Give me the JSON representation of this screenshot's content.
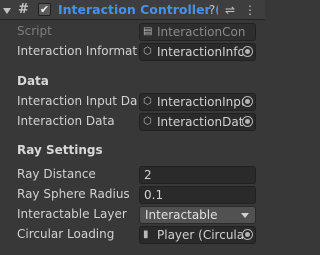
{
  "header": {
    "title": "Interaction Controller (S",
    "enabled_mark": "✔",
    "help_icon": "question-icon",
    "presets_icon": "sliders-icon",
    "menu_icon": "kebab-menu-icon"
  },
  "fields": {
    "script": {
      "label": "Script",
      "value": "InteractionCon"
    },
    "interaction_information": {
      "label": "Interaction Informatio",
      "value": "InteractionInfor"
    }
  },
  "sections": {
    "data": {
      "title": "Data",
      "interaction_input_data": {
        "label": "Interaction Input Data",
        "value": "InteractionInpu"
      },
      "interaction_data": {
        "label": "Interaction Data",
        "value": "InteractionData"
      }
    },
    "ray_settings": {
      "title": "Ray Settings",
      "ray_distance": {
        "label": "Ray Distance",
        "value": "2"
      },
      "ray_sphere_radius": {
        "label": "Ray Sphere Radius",
        "value": "0.1"
      },
      "interactable_layer": {
        "label": "Interactable Layer",
        "value": "Interactable"
      },
      "circular_loading": {
        "label": "Circular Loading",
        "value": "Player (Circula"
      }
    }
  },
  "colors": {
    "title": "#4c8fe8",
    "background": "#383838"
  }
}
